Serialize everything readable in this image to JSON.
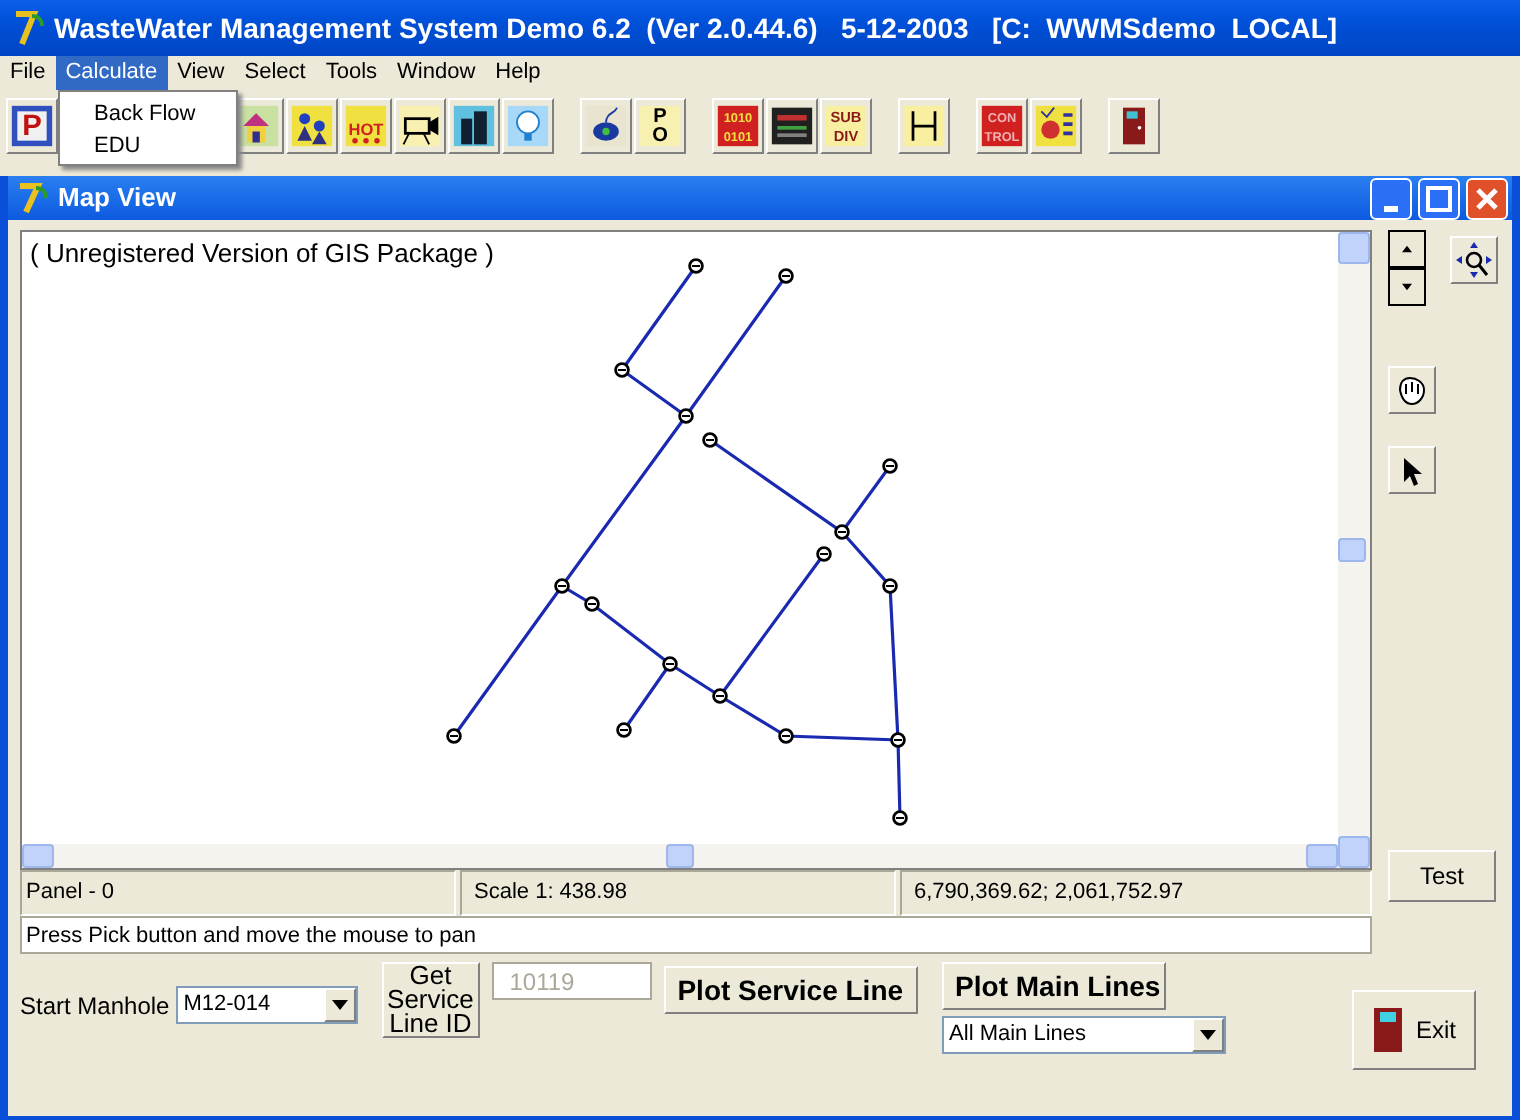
{
  "window": {
    "title": "WasteWater Management System Demo 6.2  (Ver 2.0.44.6)   5-12-2003   [C:  WWMSdemo  LOCAL]"
  },
  "menu": [
    {
      "label": "File",
      "selected": false
    },
    {
      "label": "Calculate",
      "selected": true
    },
    {
      "label": "View",
      "selected": false
    },
    {
      "label": "Select",
      "selected": false
    },
    {
      "label": "Tools",
      "selected": false
    },
    {
      "label": "Window",
      "selected": false
    },
    {
      "label": "Help",
      "selected": false
    }
  ],
  "dropdown": {
    "items": [
      "Back Flow",
      "EDU"
    ]
  },
  "toolbar": [
    {
      "kind": "p",
      "lines": [
        "P"
      ]
    },
    {
      "kind": "gap"
    },
    {
      "kind": "house"
    },
    {
      "kind": "people"
    },
    {
      "kind": "hot",
      "lines": [
        "HOT"
      ]
    },
    {
      "kind": "camera"
    },
    {
      "kind": "building"
    },
    {
      "kind": "bulb"
    },
    {
      "kind": "sep"
    },
    {
      "kind": "mouse"
    },
    {
      "kind": "po",
      "lines": [
        "P",
        "O"
      ]
    },
    {
      "kind": "sep"
    },
    {
      "kind": "binary",
      "lines": [
        "1010",
        "0101"
      ]
    },
    {
      "kind": "panel"
    },
    {
      "kind": "subdiv",
      "lines": [
        "SUB",
        "DIV"
      ]
    },
    {
      "kind": "sep"
    },
    {
      "kind": "network"
    },
    {
      "kind": "sep"
    },
    {
      "kind": "control",
      "lines": [
        "CON",
        "TROL"
      ]
    },
    {
      "kind": "checklist"
    },
    {
      "kind": "sep"
    },
    {
      "kind": "door"
    }
  ],
  "map_view": {
    "title": "Map View",
    "notice": "( Unregistered Version of GIS Package )"
  },
  "test_button": "Test",
  "status": {
    "panel": "Panel - 0",
    "scale": "Scale 1: 438.98",
    "coords": "6,790,369.62; 2,061,752.97"
  },
  "message": "Press Pick button and move the mouse to pan",
  "start_manhole": {
    "label": "Start Manhole",
    "value": "M12-014"
  },
  "get_id_button": "Get Service Line ID",
  "service_line_id": {
    "value": "10119",
    "disabled": true
  },
  "plot_service_button": "Plot Service Line",
  "plot_main_button": "Plot Main Lines",
  "main_lines_select": {
    "value": "All Main Lines"
  },
  "exit_button": "Exit"
}
